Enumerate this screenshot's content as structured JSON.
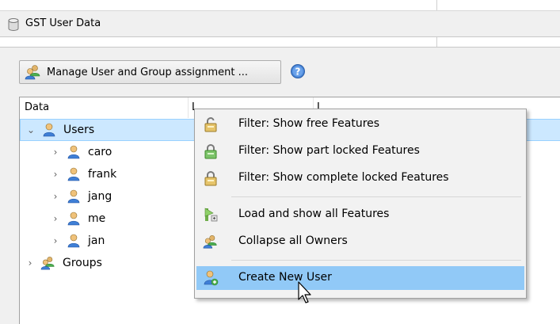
{
  "window": {
    "title": "GST User Data"
  },
  "toolbar": {
    "manage_label": "Manage User and Group assignment ..."
  },
  "table": {
    "columns": [
      "Data",
      "L",
      "L"
    ],
    "rows": [
      {
        "label": "Users",
        "level": 0,
        "expanded": true,
        "selected": true,
        "icon": "user-icon"
      },
      {
        "label": "caro",
        "level": 1,
        "expanded": false,
        "icon": "user-icon"
      },
      {
        "label": "frank",
        "level": 1,
        "expanded": false,
        "icon": "user-icon"
      },
      {
        "label": "jang",
        "level": 1,
        "expanded": false,
        "icon": "user-icon"
      },
      {
        "label": "me",
        "level": 1,
        "expanded": false,
        "icon": "user-icon"
      },
      {
        "label": "jan",
        "level": 1,
        "expanded": false,
        "icon": "user-icon"
      },
      {
        "label": "Groups",
        "level": 0,
        "expanded": false,
        "icon": "group-icon"
      }
    ]
  },
  "context_menu": {
    "items": [
      {
        "label": "Filter: Show free Features",
        "icon": "lock-free-icon"
      },
      {
        "label": "Filter: Show part locked Features",
        "icon": "lock-partial-icon"
      },
      {
        "label": "Filter: Show complete locked Features",
        "icon": "lock-complete-icon"
      },
      {
        "label": "Load and show all Features",
        "icon": "load-features-icon"
      },
      {
        "label": "Collapse all Owners",
        "icon": "collapse-owners-icon"
      },
      {
        "label": "Create New User",
        "icon": "add-user-icon",
        "hovered": true
      }
    ]
  },
  "colors": {
    "selection": "#cce8ff",
    "menu_hover": "#91c9f7",
    "panel_bg": "#f0f0f0"
  }
}
